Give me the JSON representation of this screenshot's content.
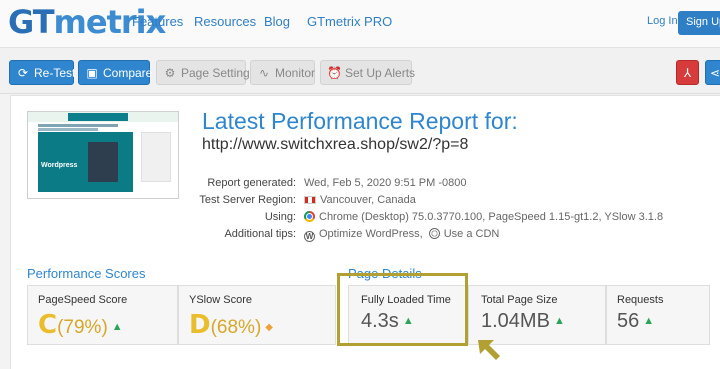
{
  "nav": {
    "logo_a": "GT",
    "logo_b": "metrix",
    "links": [
      "Features",
      "Resources",
      "Blog",
      "GTmetrix PRO"
    ],
    "login": "Log In",
    "signup": "Sign Up"
  },
  "toolbar": {
    "retest": "Re-Test",
    "compare": "Compare",
    "page_settings": "Page Settings",
    "monitor": "Monitor",
    "alerts": "Set Up Alerts"
  },
  "report": {
    "title": "Latest Performance Report for:",
    "url": "http://www.switchxrea.shop/sw2/?p=8",
    "thumb_text": "Wordpress",
    "rows": [
      {
        "label": "Report generated:",
        "value": "Wed, Feb 5, 2020 9:51 PM -0800"
      },
      {
        "label": "Test Server Region:",
        "value": "Vancouver, Canada"
      },
      {
        "label": "Using:",
        "value": "Chrome (Desktop) 75.0.3770.100, PageSpeed 1.15-gt1.2, YSlow 3.1.8"
      },
      {
        "label": "Additional tips:",
        "value_a": "Optimize WordPress,",
        "value_b": "Use a CDN"
      }
    ]
  },
  "scores": {
    "heading": "Performance Scores",
    "pagespeed_label": "PageSpeed Score",
    "pagespeed_grade": "C",
    "pagespeed_pct": "(79%)",
    "yslow_label": "YSlow Score",
    "yslow_grade": "D",
    "yslow_pct": "(68%)"
  },
  "details": {
    "heading": "Page Details",
    "load_label": "Fully Loaded Time",
    "load_value": "4.3s",
    "size_label": "Total Page Size",
    "size_value": "1.04MB",
    "req_label": "Requests",
    "req_value": "56"
  },
  "colors": {
    "accent": "#2f86cf",
    "grade": "#e9bd2b",
    "highlight": "#b3a033",
    "up": "#2ca55a"
  }
}
